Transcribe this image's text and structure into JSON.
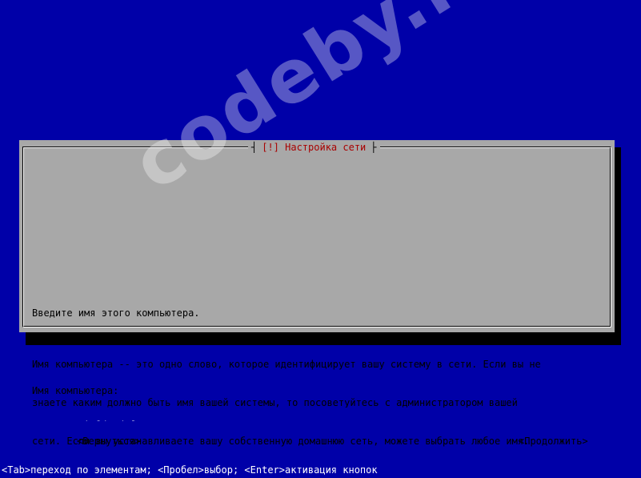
{
  "dialog": {
    "title_left": "┤",
    "title": "[!] Настройка сети",
    "title_right": "├",
    "line1": "Введите имя этого компьютера.",
    "paragraph_line1": "Имя компьютера -- это одно слово, которое идентифицирует вашу систему в сети. Если вы не",
    "paragraph_line2": "знаете каким должно быть имя вашей системы, то посоветуйтесь с администратором вашей",
    "paragraph_line3": "сети. Если вы устанавливаете вашу собственную домашнюю сеть, можете выбрать любое имя.",
    "field_label": "Имя компьютера:",
    "field_value": "kali-mial",
    "back_button": "<Вернуться>",
    "continue_button": "<Продолжить>"
  },
  "footer": {
    "help": "<Tab>переход по элементам; <Пробел>выбор; <Enter>активация кнопок"
  },
  "watermark": {
    "text": "codeby.net"
  },
  "colors": {
    "background": "#0000a8",
    "dialog": "#a8a8a8",
    "title": "#a80000"
  }
}
